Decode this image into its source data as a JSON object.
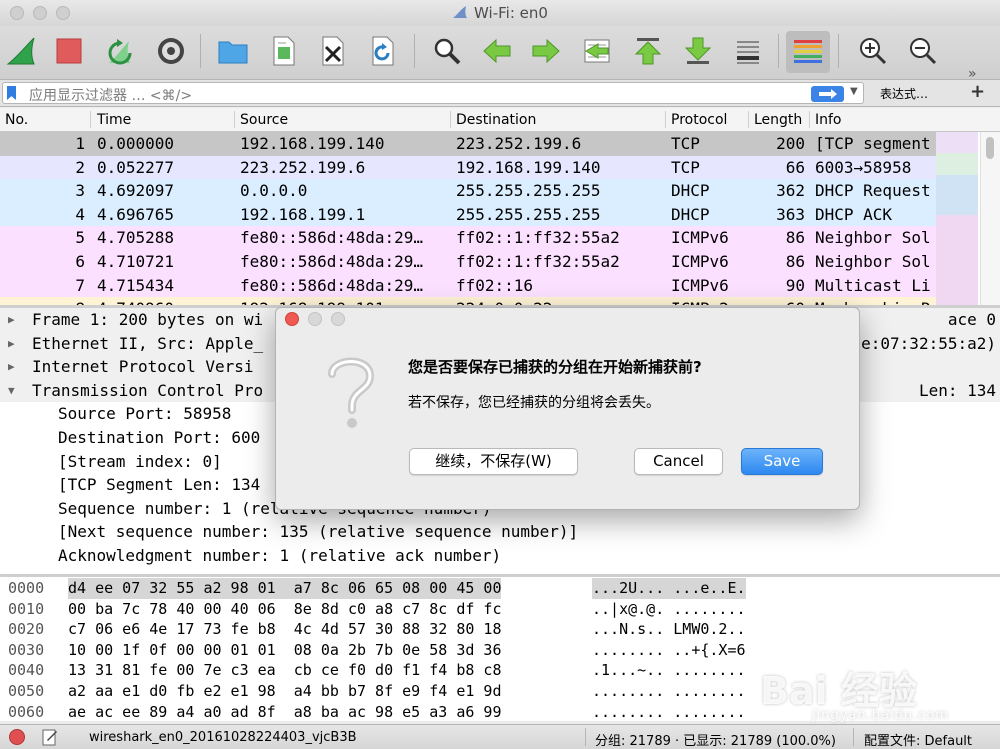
{
  "window": {
    "title": "Wi-Fi: en0"
  },
  "toolbar": {
    "icons": [
      "shark-fin-start-icon",
      "stop-capture-icon",
      "restart-capture-icon",
      "capture-options-icon",
      "open-folder-icon",
      "save-file-icon",
      "close-file-icon",
      "reload-file-icon",
      "find-packet-icon",
      "go-back-icon",
      "go-forward-icon",
      "go-to-packet-icon",
      "first-packet-icon",
      "last-packet-icon",
      "autoscroll-icon",
      "colorize-icon",
      "zoom-in-icon",
      "zoom-out-icon",
      "normal-size-icon"
    ]
  },
  "filter": {
    "placeholder": "应用显示过滤器 … <⌘/>",
    "expression_label": "表达式…",
    "add_label": "+"
  },
  "packet_list": {
    "columns": [
      "No.",
      "Time",
      "Source",
      "Destination",
      "Protocol",
      "Length",
      "Info"
    ],
    "rows": [
      {
        "no": "1",
        "time": "0.000000",
        "src": "192.168.199.140",
        "dst": "223.252.199.6",
        "proto": "TCP",
        "len": "200",
        "info": "[TCP segment",
        "color": "#c6c6c6"
      },
      {
        "no": "2",
        "time": "0.052277",
        "src": "223.252.199.6",
        "dst": "192.168.199.140",
        "proto": "TCP",
        "len": "66",
        "info": "6003→58958",
        "color": "#e7e6ff"
      },
      {
        "no": "3",
        "time": "4.692097",
        "src": "0.0.0.0",
        "dst": "255.255.255.255",
        "proto": "DHCP",
        "len": "362",
        "info": "DHCP Request",
        "color": "#daeeff"
      },
      {
        "no": "4",
        "time": "4.696765",
        "src": "192.168.199.1",
        "dst": "255.255.255.255",
        "proto": "DHCP",
        "len": "363",
        "info": "DHCP ACK",
        "color": "#daeeff"
      },
      {
        "no": "5",
        "time": "4.705288",
        "src": "fe80::586d:48da:29…",
        "dst": "ff02::1:ff32:55a2",
        "proto": "ICMPv6",
        "len": "86",
        "info": "Neighbor Sol",
        "color": "#fce0ff"
      },
      {
        "no": "6",
        "time": "4.710721",
        "src": "fe80::586d:48da:29…",
        "dst": "ff02::1:ff32:55a2",
        "proto": "ICMPv6",
        "len": "86",
        "info": "Neighbor Sol",
        "color": "#fce0ff"
      },
      {
        "no": "7",
        "time": "4.715434",
        "src": "fe80::586d:48da:29…",
        "dst": "ff02::16",
        "proto": "ICMPv6",
        "len": "90",
        "info": "Multicast Li",
        "color": "#fce0ff"
      },
      {
        "no": "8",
        "time": "4.740960",
        "src": "192.168.199.101",
        "dst": "224.0.0.22",
        "proto": "ICMPv2",
        "len": "60",
        "info": "Membership R",
        "color": "#fff3d6"
      }
    ]
  },
  "details": {
    "rows": [
      {
        "arrow": "▶",
        "text": "Frame 1: 200 bytes on wi",
        "tail": "ace 0",
        "indent": 0,
        "expanded": false
      },
      {
        "arrow": "▶",
        "text": "Ethernet II, Src: Apple_",
        "tail": "e:07:32:55:a2)",
        "indent": 0,
        "expanded": false
      },
      {
        "arrow": "▶",
        "text": "Internet Protocol Versi",
        "tail": "",
        "indent": 0,
        "expanded": false
      },
      {
        "arrow": "▼",
        "text": "Transmission Control Pro",
        "tail": "Len: 134",
        "indent": 0,
        "expanded": true
      },
      {
        "arrow": "",
        "text": "Source Port: 58958",
        "tail": "",
        "indent": 1
      },
      {
        "arrow": "",
        "text": "Destination Port: 600",
        "tail": "",
        "indent": 1
      },
      {
        "arrow": "",
        "text": "[Stream index: 0]",
        "tail": "",
        "indent": 1
      },
      {
        "arrow": "",
        "text": "[TCP Segment Len: 134",
        "tail": "",
        "indent": 1
      },
      {
        "arrow": "",
        "text": "Sequence number: 1    (relative sequence number)",
        "tail": "",
        "indent": 1
      },
      {
        "arrow": "",
        "text": "[Next sequence number: 135    (relative sequence number)]",
        "tail": "",
        "indent": 1
      },
      {
        "arrow": "",
        "text": "Acknowledgment number: 1    (relative ack number)",
        "tail": "",
        "indent": 1
      }
    ]
  },
  "hex": {
    "rows": [
      {
        "offset": "0000",
        "bytes": "d4 ee 07 32 55 a2 98 01  a7 8c 06 65 08 00 45 00",
        "ascii": "...2U... ...e..E."
      },
      {
        "offset": "0010",
        "bytes": "00 ba 7c 78 40 00 40 06  8e 8d c0 a8 c7 8c df fc",
        "ascii": "..|x@.@. ........"
      },
      {
        "offset": "0020",
        "bytes": "c7 06 e6 4e 17 73 fe b8  4c 4d 57 30 88 32 80 18",
        "ascii": "...N.s.. LMW0.2.."
      },
      {
        "offset": "0030",
        "bytes": "10 00 1f 0f 00 00 01 01  08 0a 2b 7b 0e 58 3d 36",
        "ascii": "........ ..+{.X=6"
      },
      {
        "offset": "0040",
        "bytes": "13 31 81 fe 00 7e c3 ea  cb ce f0 d0 f1 f4 b8 c8",
        "ascii": ".1...~.. ........"
      },
      {
        "offset": "0050",
        "bytes": "a2 aa e1 d0 fb e2 e1 98  a4 bb b7 8f e9 f4 e1 9d",
        "ascii": "........ ........"
      },
      {
        "offset": "0060",
        "bytes": "ae ac ee 89 a4 a0 ad 8f  a8 ba ac 98 e5 a3 a6 99",
        "ascii": "........ ........"
      }
    ]
  },
  "status": {
    "filename": "wireshark_en0_20161028224403_vjcB3B",
    "counts": "分组: 21789 · 已显示: 21789 (100.0%)",
    "profile": "配置文件: Default"
  },
  "dialog": {
    "title": "您是否要保存已捕获的分组在开始新捕获前?",
    "message": "若不保存，您已经捕获的分组将会丢失。",
    "continue_label": "继续，不保存(W)",
    "cancel_label": "Cancel",
    "save_label": "Save"
  },
  "watermark": {
    "text": "Bai 经验",
    "sub": "jingyan.baidu.com"
  },
  "colors": {
    "accent": "#2d88f0",
    "fin_green": "#2fa24b",
    "stop_red": "#e05c5c"
  }
}
